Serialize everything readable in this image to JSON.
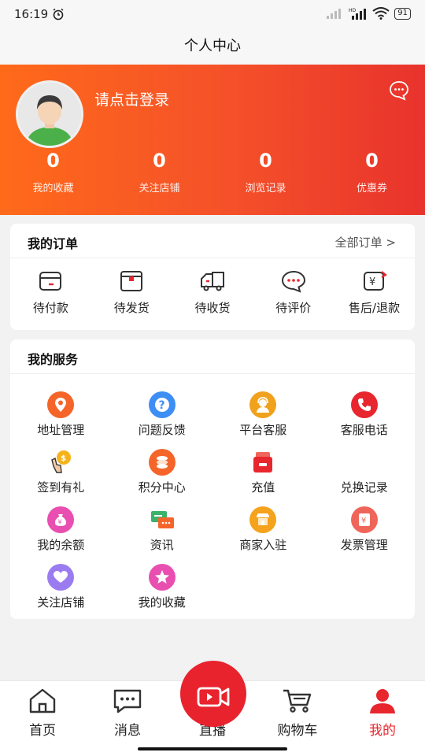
{
  "status_bar": {
    "time": "16:19",
    "battery": "91"
  },
  "nav": {
    "title": "个人中心"
  },
  "header": {
    "login_text": "请点击登录",
    "stats": [
      {
        "value": "0",
        "label": "我的收藏"
      },
      {
        "value": "0",
        "label": "关注店铺"
      },
      {
        "value": "0",
        "label": "浏览记录"
      },
      {
        "value": "0",
        "label": "优惠券"
      }
    ]
  },
  "orders": {
    "title": "我的订单",
    "more": "全部订单 >",
    "items": [
      {
        "label": "待付款",
        "icon": "wallet-icon"
      },
      {
        "label": "待发货",
        "icon": "package-icon"
      },
      {
        "label": "待收货",
        "icon": "truck-icon"
      },
      {
        "label": "待评价",
        "icon": "comment-icon"
      },
      {
        "label": "售后/退款",
        "icon": "refund-icon"
      }
    ]
  },
  "services": {
    "title": "我的服务",
    "items": [
      {
        "label": "地址管理",
        "icon": "location-icon",
        "color": "#f5652a"
      },
      {
        "label": "问题反馈",
        "icon": "question-icon",
        "color": "#3d8ef5"
      },
      {
        "label": "平台客服",
        "icon": "support-agent-icon",
        "color": "#f0a21c"
      },
      {
        "label": "客服电话",
        "icon": "phone-icon",
        "color": "#e8262e"
      },
      {
        "label": "签到有礼",
        "icon": "sign-in-icon",
        "color": "#f5b21b"
      },
      {
        "label": "积分中心",
        "icon": "coins-icon",
        "color": "#f5652a"
      },
      {
        "label": "充值",
        "icon": "recharge-wallet-icon",
        "color": "#e8262e"
      },
      {
        "label": "兑换记录",
        "icon": "exchange-icon",
        "color": "#ffffff"
      },
      {
        "label": "我的余额",
        "icon": "money-bag-icon",
        "color": "#e84fb0"
      },
      {
        "label": "资讯",
        "icon": "news-chat-icon",
        "color": "#3bb36a"
      },
      {
        "label": "商家入驻",
        "icon": "store-icon",
        "color": "#f5a21c"
      },
      {
        "label": "发票管理",
        "icon": "invoice-icon",
        "color": "#f0655a"
      },
      {
        "label": "关注店铺",
        "icon": "heart-icon",
        "color": "#9b7cf0"
      },
      {
        "label": "我的收藏",
        "icon": "star-icon",
        "color": "#e84fb0"
      }
    ]
  },
  "tabbar": {
    "items": [
      {
        "label": "首页",
        "icon": "home-icon"
      },
      {
        "label": "消息",
        "icon": "message-icon"
      },
      {
        "label": "直播",
        "icon": "live-video-icon"
      },
      {
        "label": "购物车",
        "icon": "cart-icon"
      },
      {
        "label": "我的",
        "icon": "user-icon"
      }
    ],
    "active": "我的",
    "accent": "#e8262e"
  }
}
